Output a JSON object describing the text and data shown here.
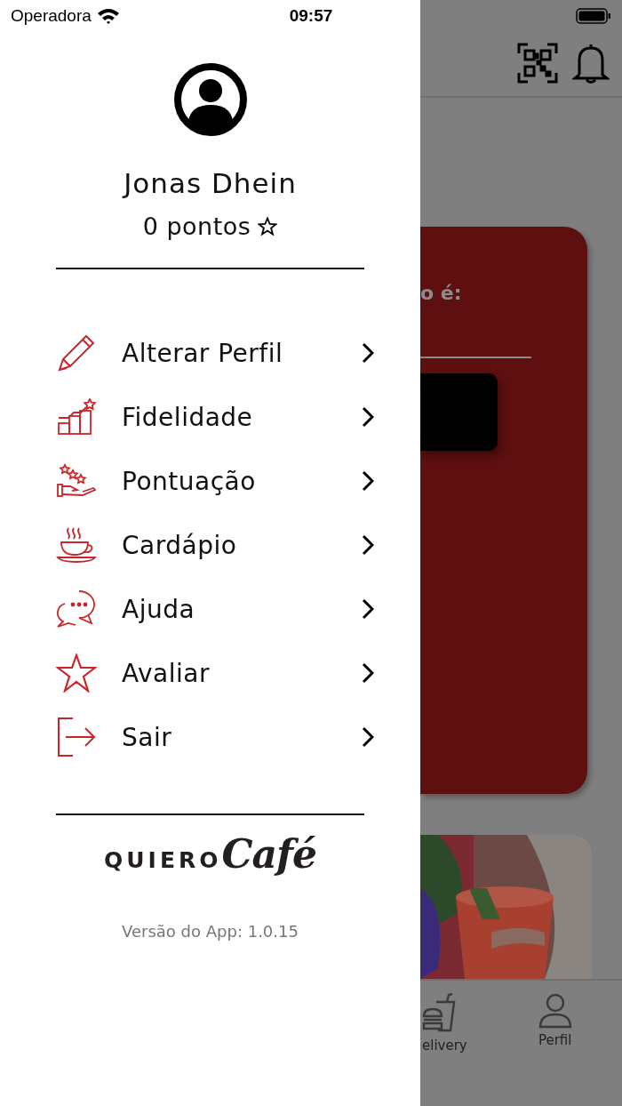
{
  "status_bar": {
    "carrier": "Operadora",
    "time": "09:57"
  },
  "drawer": {
    "user_name": "Jonas Dhein",
    "points": "0 pontos",
    "menu": [
      {
        "kind": "pencil",
        "label": "Alterar Perfil"
      },
      {
        "kind": "chart",
        "label": "Fidelidade"
      },
      {
        "kind": "hand",
        "label": "Pontuação"
      },
      {
        "kind": "cup",
        "label": "Cardápio"
      },
      {
        "kind": "chat",
        "label": "Ajuda"
      },
      {
        "kind": "star",
        "label": "Avaliar"
      },
      {
        "kind": "exit",
        "label": "Sair"
      }
    ],
    "logo": {
      "first": "QUIERO",
      "second": "Café"
    },
    "version": "Versão do App: 1.0.15"
  },
  "background": {
    "card_text": "o é:",
    "tabs": [
      {
        "kind": "burger",
        "label": "elivery"
      },
      {
        "kind": "person",
        "label": "Perfil"
      }
    ]
  }
}
